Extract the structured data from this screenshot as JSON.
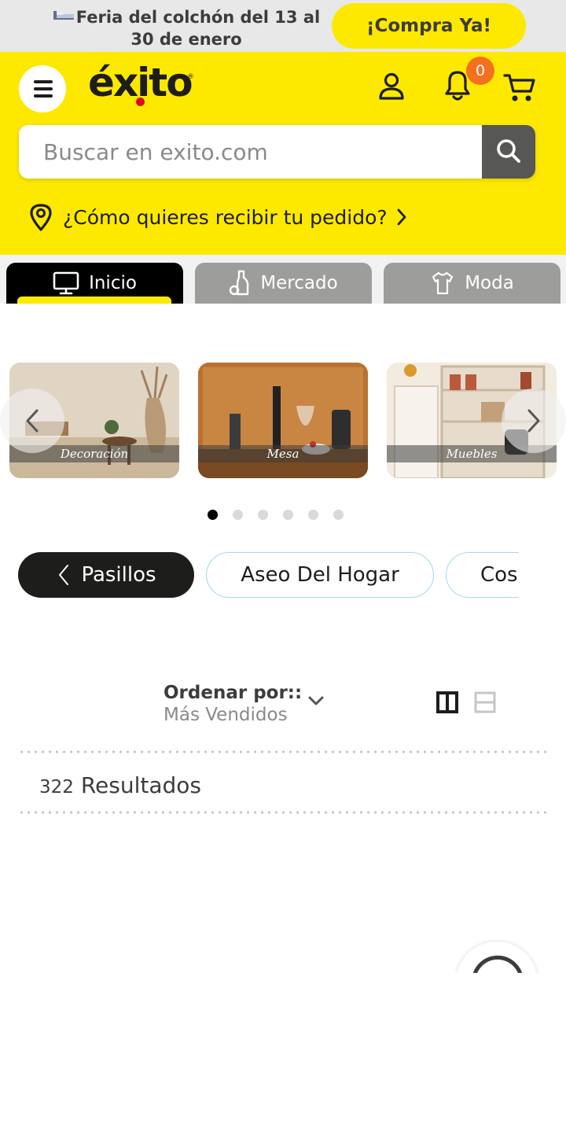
{
  "promo": {
    "text": "Feria del colchón del 13 al 30 de enero",
    "button_label": "¡Compra Ya!"
  },
  "header": {
    "logo_text": "éxito",
    "logo_registered": "®",
    "notifications_count": "0",
    "search_placeholder": "Buscar en exito.com",
    "delivery_prompt": "¿Cómo quieres recibir tu pedido?"
  },
  "tabs": [
    {
      "label": "Inicio",
      "icon": "monitor-icon",
      "active": true
    },
    {
      "label": "Mercado",
      "icon": "bottle-icon",
      "active": false
    },
    {
      "label": "Moda",
      "icon": "shirt-icon",
      "active": false
    }
  ],
  "carousel": {
    "items": [
      {
        "label": "Decoración"
      },
      {
        "label": "Mesa"
      },
      {
        "label": "Muebles"
      }
    ],
    "page_count": 6,
    "active_page": 1
  },
  "aisles": {
    "back_label": "Pasillos",
    "items": [
      "Aseo Del Hogar",
      "Cos"
    ]
  },
  "sort": {
    "label": "Ordenar por::",
    "value": "Más Vendidos"
  },
  "results": {
    "count": "322",
    "label": "Resultados"
  },
  "colors": {
    "brand_yellow": "#fde900",
    "badge_orange": "#f37021",
    "dark": "#1d1d1b"
  }
}
